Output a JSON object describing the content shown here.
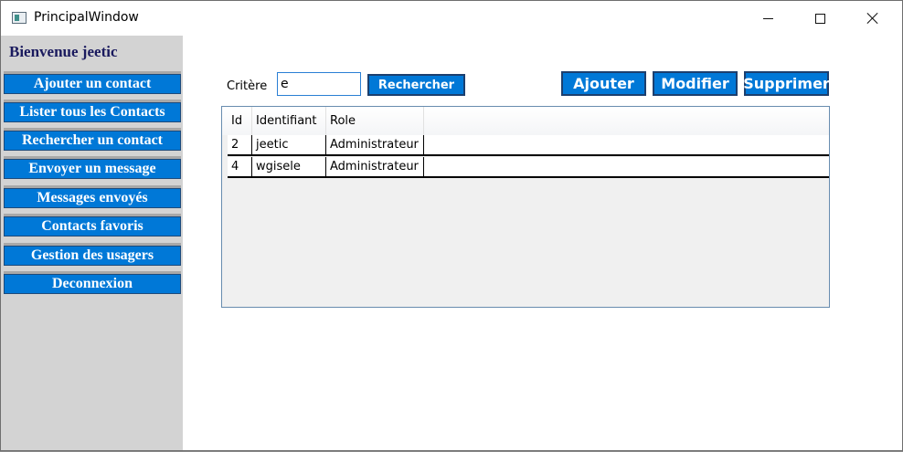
{
  "window": {
    "title": "PrincipalWindow"
  },
  "sidebar": {
    "welcome": "Bienvenue jeetic",
    "items": [
      {
        "label": "Ajouter un contact"
      },
      {
        "label": "Lister tous les Contacts"
      },
      {
        "label": "Rechercher un contact"
      },
      {
        "label": "Envoyer un message"
      },
      {
        "label": "Messages envoyés"
      },
      {
        "label": "Contacts favoris"
      },
      {
        "label": "Gestion des usagers"
      },
      {
        "label": "Deconnexion"
      }
    ]
  },
  "search": {
    "label": "Critère",
    "value": "e",
    "button": "Rechercher"
  },
  "actions": {
    "add": "Ajouter",
    "edit": "Modifier",
    "delete": "Supprimer"
  },
  "table": {
    "columns": [
      "Id",
      "Identifiant",
      "Role"
    ],
    "rows": [
      {
        "id": "2",
        "identifiant": "jeetic",
        "role": "Administrateur"
      },
      {
        "id": "4",
        "identifiant": "wgisele",
        "role": "Administrateur"
      }
    ]
  },
  "colors": {
    "accent": "#0078d7",
    "sidebar_bg": "#d3d3d3",
    "welcome_text": "#1a1a5e"
  }
}
